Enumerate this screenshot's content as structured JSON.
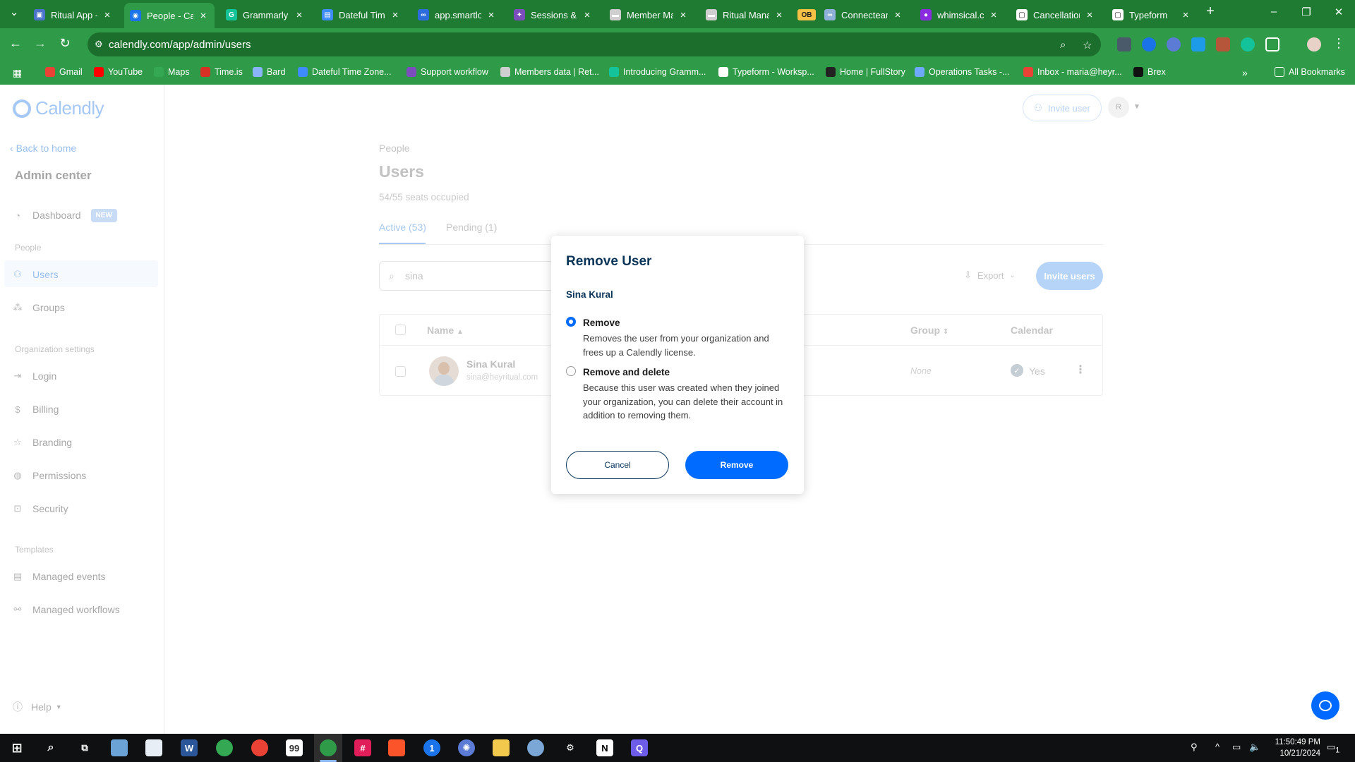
{
  "browser": {
    "tabs": [
      {
        "label": "Ritual App -",
        "color": "#4a73c9",
        "glyph": "▣",
        "active": false
      },
      {
        "label": "People - Cal",
        "color": "#1a73e8",
        "glyph": "◉",
        "active": true
      },
      {
        "label": "Grammarly",
        "color": "#15c39a",
        "glyph": "G",
        "active": false
      },
      {
        "label": "Dateful Tim",
        "color": "#3d8bfd",
        "glyph": "▤",
        "active": false
      },
      {
        "label": "app.smartlo",
        "color": "#2d6cdf",
        "glyph": "∞",
        "active": false
      },
      {
        "label": "Sessions & R",
        "color": "#7c4dbd",
        "glyph": "✦",
        "active": false
      },
      {
        "label": "Member Ma",
        "color": "#cfcfcf",
        "glyph": "▬",
        "active": false
      },
      {
        "label": "Ritual Mana",
        "color": "#cfcfcf",
        "glyph": "▬",
        "active": false
      },
      {
        "label": "OB",
        "color": "#f6c144",
        "glyph": "OB",
        "active": false
      },
      {
        "label": "Connecteam",
        "color": "#8fb0d8",
        "glyph": "∞",
        "active": false
      },
      {
        "label": "whimsical.co",
        "color": "#8a2be2",
        "glyph": "●",
        "active": false
      },
      {
        "label": "Cancellation",
        "color": "#ffffff",
        "glyph": "▢",
        "active": false
      },
      {
        "label": "Typeform",
        "color": "#ffffff",
        "glyph": "▢",
        "active": false
      }
    ],
    "url": "calendly.com/app/admin/users",
    "bookmarks": [
      {
        "label": "Gmail",
        "color": "#ea4335"
      },
      {
        "label": "YouTube",
        "color": "#ff0000"
      },
      {
        "label": "Maps",
        "color": "#34a853"
      },
      {
        "label": "Time.is",
        "color": "#d93025"
      },
      {
        "label": "Bard",
        "color": "#8ab4f8"
      },
      {
        "label": "Dateful Time Zone...",
        "color": "#3d8bfd"
      },
      {
        "label": "Support workflow",
        "color": "#7c4dbd"
      },
      {
        "label": "Members data | Ret...",
        "color": "#cfcfcf"
      },
      {
        "label": "Introducing Gramm...",
        "color": "#15c39a"
      },
      {
        "label": "Typeform - Worksp...",
        "color": "#ffffff"
      },
      {
        "label": "Home | FullStory",
        "color": "#222222"
      },
      {
        "label": "Operations Tasks -...",
        "color": "#6fa8ff"
      },
      {
        "label": "Inbox - maria@heyr...",
        "color": "#ea4335"
      },
      {
        "label": "Brex",
        "color": "#111111"
      }
    ],
    "all_bookmarks": "All Bookmarks"
  },
  "sidebar": {
    "logo_text": "Calendly",
    "back_link": "Back to home",
    "title": "Admin center",
    "dashboard": "Dashboard",
    "new_badge": "NEW",
    "section_people": "People",
    "users": "Users",
    "groups": "Groups",
    "section_org": "Organization settings",
    "login": "Login",
    "billing": "Billing",
    "branding": "Branding",
    "permissions": "Permissions",
    "security": "Security",
    "section_templates": "Templates",
    "managed_events": "Managed events",
    "managed_workflows": "Managed workflows",
    "help": "Help"
  },
  "header": {
    "invite_user": "Invite user",
    "avatar_initial": "R"
  },
  "main": {
    "breadcrumb": "People",
    "title": "Users",
    "seats": "54/55 seats occupied",
    "tab_active": "Active (53)",
    "tab_pending": "Pending (1)",
    "search_value": "sina",
    "export": "Export",
    "invite_users": "Invite users",
    "columns": {
      "name": "Name",
      "group": "Group",
      "calendar": "Calendar"
    },
    "row": {
      "name": "Sina Kural",
      "email": "sina@heyritual.com",
      "group": "None",
      "calendar": "Yes"
    }
  },
  "modal": {
    "title": "Remove User",
    "user": "Sina Kural",
    "option1_label": "Remove",
    "option1_desc": "Removes the user from your organization and frees up a Calendly license.",
    "option2_label": "Remove and delete",
    "option2_desc": "Because this user was created when they joined your organization, you can delete their account in addition to removing them.",
    "selected_option": "Remove",
    "cancel": "Cancel",
    "confirm": "Remove"
  },
  "taskbar": {
    "time": "11:50:49 PM",
    "date": "10/21/2024",
    "notification_count": "1"
  },
  "colors": {
    "chrome_green": "#2f9a47",
    "calendly_blue": "#006bff",
    "modal_text": "#0b3558"
  }
}
